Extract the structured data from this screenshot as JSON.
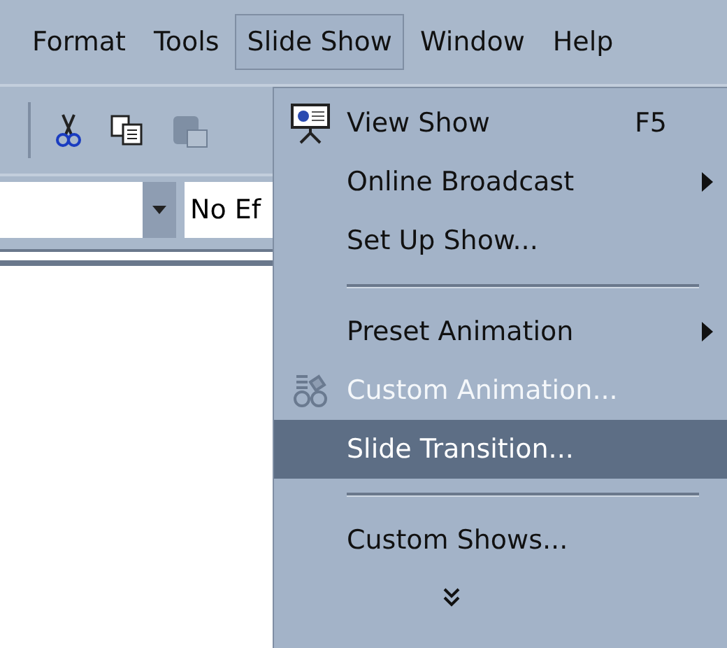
{
  "menubar": [
    {
      "label": "Format",
      "selected": false
    },
    {
      "label": "Tools",
      "selected": false
    },
    {
      "label": "Slide Show",
      "selected": true
    },
    {
      "label": "Window",
      "selected": false
    },
    {
      "label": "Help",
      "selected": false
    }
  ],
  "toolbar": [
    {
      "kind": "cut",
      "disabled": false
    },
    {
      "kind": "copy",
      "disabled": false
    },
    {
      "kind": "paste",
      "disabled": true
    }
  ],
  "effect_field": {
    "value": "No Ef"
  },
  "menu": {
    "items": [
      {
        "kind": "item",
        "label": "View Show",
        "shortcut": "F5",
        "submenu": false,
        "disabled": false,
        "selected": false
      },
      {
        "kind": "item",
        "label": "Online Broadcast",
        "submenu": true,
        "disabled": false,
        "selected": false
      },
      {
        "kind": "item",
        "label": "Set Up Show...",
        "submenu": false,
        "disabled": false,
        "selected": false
      },
      {
        "kind": "separator"
      },
      {
        "kind": "item",
        "label": "Preset Animation",
        "submenu": true,
        "disabled": false,
        "selected": false
      },
      {
        "kind": "item",
        "label": "Custom Animation...",
        "submenu": false,
        "disabled": true,
        "selected": false
      },
      {
        "kind": "item",
        "label": "Slide Transition...",
        "submenu": false,
        "disabled": false,
        "selected": true
      },
      {
        "kind": "separator"
      },
      {
        "kind": "item",
        "label": "Custom Shows...",
        "submenu": false,
        "disabled": false,
        "selected": false
      },
      {
        "kind": "more"
      }
    ]
  }
}
